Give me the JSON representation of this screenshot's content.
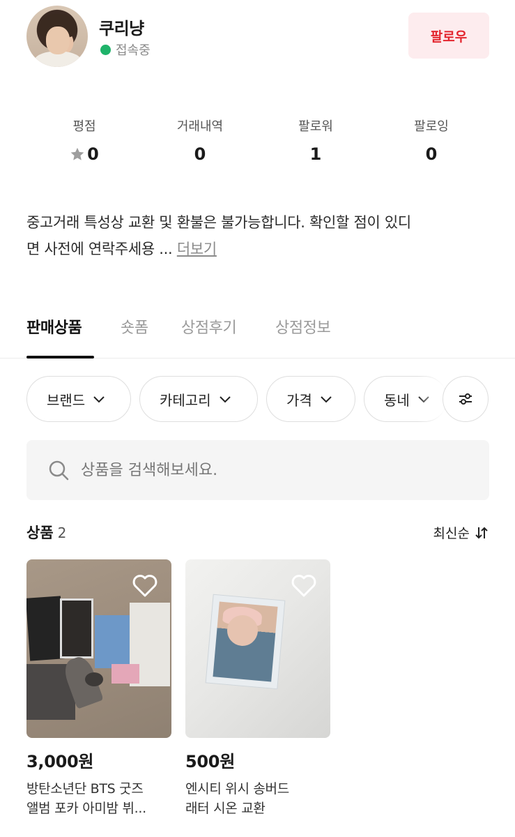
{
  "profile": {
    "name": "쿠리냥",
    "status": "접속중",
    "follow_label": "팔로우"
  },
  "stats": [
    {
      "label": "평점",
      "value": "0"
    },
    {
      "label": "거래내역",
      "value": "0"
    },
    {
      "label": "팔로워",
      "value": "1"
    },
    {
      "label": "팔로잉",
      "value": "0"
    }
  ],
  "description": {
    "line1": "중고거래 특성상 교환 및 환불은 불가능합니다. 확인할 점이 있디",
    "line2": "면 사전에 연락주세용 ...",
    "more_label": "더보기"
  },
  "tabs": [
    {
      "label": "판매상품",
      "active": true
    },
    {
      "label": "숏폼",
      "active": false
    },
    {
      "label": "상점후기",
      "active": false
    },
    {
      "label": "상점정보",
      "active": false
    }
  ],
  "filters": [
    {
      "label": "브랜드"
    },
    {
      "label": "카테고리"
    },
    {
      "label": "가격"
    },
    {
      "label": "동네"
    }
  ],
  "search": {
    "placeholder": "상품을 검색해보세요."
  },
  "products_header": {
    "title": "상품",
    "count": "2",
    "sort_label": "최신순"
  },
  "products": [
    {
      "price": "3,000원",
      "title_line1": "방탄소년단 BTS 굿즈",
      "title_line2": "앨범 포카 아미밤 뷔..."
    },
    {
      "price": "500원",
      "title_line1": "엔시티 위시 송버드",
      "title_line2": "래터 시온 교환"
    }
  ],
  "colors": {
    "accent_red": "#e3262f",
    "follow_bg": "#fdecee",
    "online_green": "#1fb36a"
  }
}
